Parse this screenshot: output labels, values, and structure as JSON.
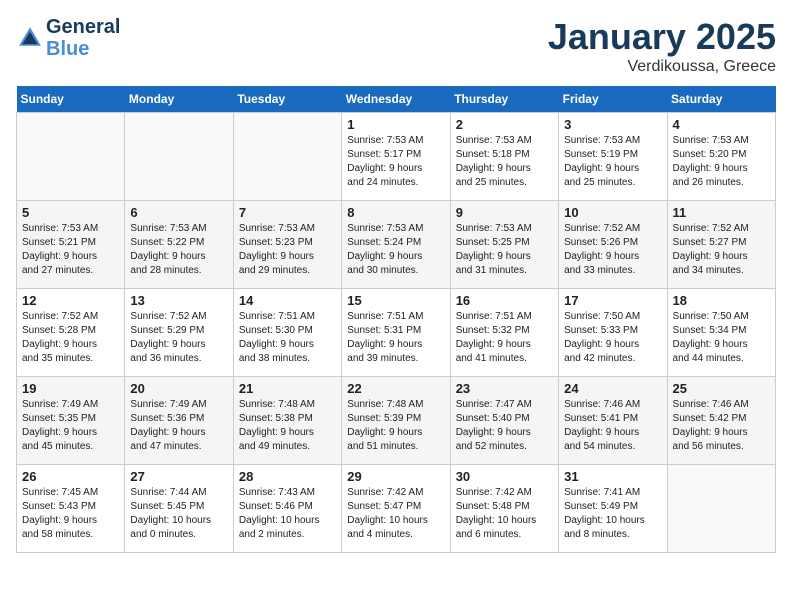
{
  "header": {
    "logo_line1": "General",
    "logo_line2": "Blue",
    "month": "January 2025",
    "location": "Verdikoussa, Greece"
  },
  "weekdays": [
    "Sunday",
    "Monday",
    "Tuesday",
    "Wednesday",
    "Thursday",
    "Friday",
    "Saturday"
  ],
  "weeks": [
    [
      {
        "day": "",
        "info": ""
      },
      {
        "day": "",
        "info": ""
      },
      {
        "day": "",
        "info": ""
      },
      {
        "day": "1",
        "info": "Sunrise: 7:53 AM\nSunset: 5:17 PM\nDaylight: 9 hours\nand 24 minutes."
      },
      {
        "day": "2",
        "info": "Sunrise: 7:53 AM\nSunset: 5:18 PM\nDaylight: 9 hours\nand 25 minutes."
      },
      {
        "day": "3",
        "info": "Sunrise: 7:53 AM\nSunset: 5:19 PM\nDaylight: 9 hours\nand 25 minutes."
      },
      {
        "day": "4",
        "info": "Sunrise: 7:53 AM\nSunset: 5:20 PM\nDaylight: 9 hours\nand 26 minutes."
      }
    ],
    [
      {
        "day": "5",
        "info": "Sunrise: 7:53 AM\nSunset: 5:21 PM\nDaylight: 9 hours\nand 27 minutes."
      },
      {
        "day": "6",
        "info": "Sunrise: 7:53 AM\nSunset: 5:22 PM\nDaylight: 9 hours\nand 28 minutes."
      },
      {
        "day": "7",
        "info": "Sunrise: 7:53 AM\nSunset: 5:23 PM\nDaylight: 9 hours\nand 29 minutes."
      },
      {
        "day": "8",
        "info": "Sunrise: 7:53 AM\nSunset: 5:24 PM\nDaylight: 9 hours\nand 30 minutes."
      },
      {
        "day": "9",
        "info": "Sunrise: 7:53 AM\nSunset: 5:25 PM\nDaylight: 9 hours\nand 31 minutes."
      },
      {
        "day": "10",
        "info": "Sunrise: 7:52 AM\nSunset: 5:26 PM\nDaylight: 9 hours\nand 33 minutes."
      },
      {
        "day": "11",
        "info": "Sunrise: 7:52 AM\nSunset: 5:27 PM\nDaylight: 9 hours\nand 34 minutes."
      }
    ],
    [
      {
        "day": "12",
        "info": "Sunrise: 7:52 AM\nSunset: 5:28 PM\nDaylight: 9 hours\nand 35 minutes."
      },
      {
        "day": "13",
        "info": "Sunrise: 7:52 AM\nSunset: 5:29 PM\nDaylight: 9 hours\nand 36 minutes."
      },
      {
        "day": "14",
        "info": "Sunrise: 7:51 AM\nSunset: 5:30 PM\nDaylight: 9 hours\nand 38 minutes."
      },
      {
        "day": "15",
        "info": "Sunrise: 7:51 AM\nSunset: 5:31 PM\nDaylight: 9 hours\nand 39 minutes."
      },
      {
        "day": "16",
        "info": "Sunrise: 7:51 AM\nSunset: 5:32 PM\nDaylight: 9 hours\nand 41 minutes."
      },
      {
        "day": "17",
        "info": "Sunrise: 7:50 AM\nSunset: 5:33 PM\nDaylight: 9 hours\nand 42 minutes."
      },
      {
        "day": "18",
        "info": "Sunrise: 7:50 AM\nSunset: 5:34 PM\nDaylight: 9 hours\nand 44 minutes."
      }
    ],
    [
      {
        "day": "19",
        "info": "Sunrise: 7:49 AM\nSunset: 5:35 PM\nDaylight: 9 hours\nand 45 minutes."
      },
      {
        "day": "20",
        "info": "Sunrise: 7:49 AM\nSunset: 5:36 PM\nDaylight: 9 hours\nand 47 minutes."
      },
      {
        "day": "21",
        "info": "Sunrise: 7:48 AM\nSunset: 5:38 PM\nDaylight: 9 hours\nand 49 minutes."
      },
      {
        "day": "22",
        "info": "Sunrise: 7:48 AM\nSunset: 5:39 PM\nDaylight: 9 hours\nand 51 minutes."
      },
      {
        "day": "23",
        "info": "Sunrise: 7:47 AM\nSunset: 5:40 PM\nDaylight: 9 hours\nand 52 minutes."
      },
      {
        "day": "24",
        "info": "Sunrise: 7:46 AM\nSunset: 5:41 PM\nDaylight: 9 hours\nand 54 minutes."
      },
      {
        "day": "25",
        "info": "Sunrise: 7:46 AM\nSunset: 5:42 PM\nDaylight: 9 hours\nand 56 minutes."
      }
    ],
    [
      {
        "day": "26",
        "info": "Sunrise: 7:45 AM\nSunset: 5:43 PM\nDaylight: 9 hours\nand 58 minutes."
      },
      {
        "day": "27",
        "info": "Sunrise: 7:44 AM\nSunset: 5:45 PM\nDaylight: 10 hours\nand 0 minutes."
      },
      {
        "day": "28",
        "info": "Sunrise: 7:43 AM\nSunset: 5:46 PM\nDaylight: 10 hours\nand 2 minutes."
      },
      {
        "day": "29",
        "info": "Sunrise: 7:42 AM\nSunset: 5:47 PM\nDaylight: 10 hours\nand 4 minutes."
      },
      {
        "day": "30",
        "info": "Sunrise: 7:42 AM\nSunset: 5:48 PM\nDaylight: 10 hours\nand 6 minutes."
      },
      {
        "day": "31",
        "info": "Sunrise: 7:41 AM\nSunset: 5:49 PM\nDaylight: 10 hours\nand 8 minutes."
      },
      {
        "day": "",
        "info": ""
      }
    ]
  ]
}
